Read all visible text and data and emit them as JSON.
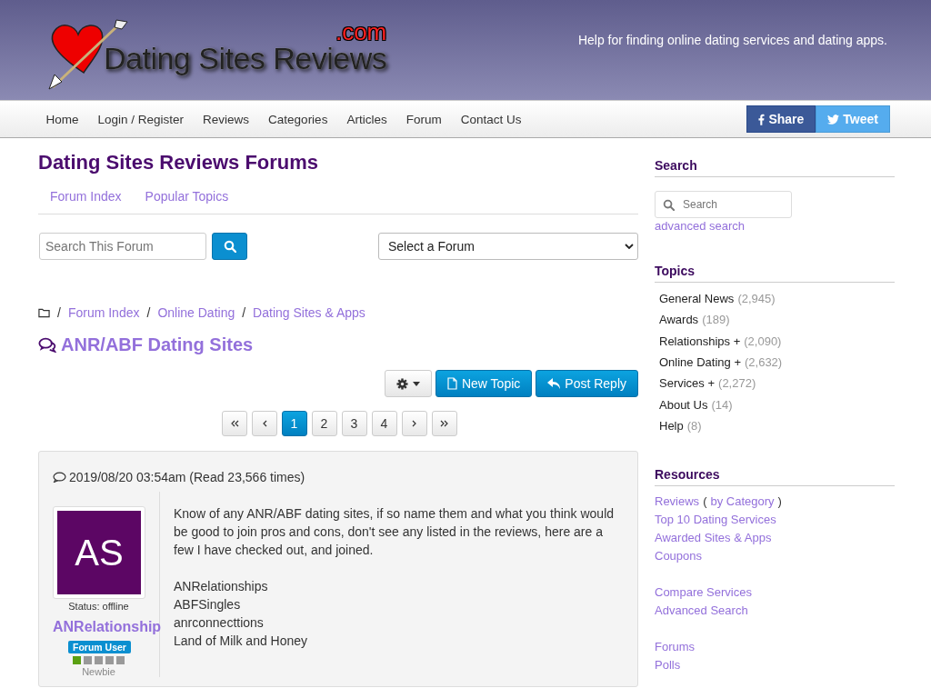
{
  "header": {
    "logo_text": "Dating Sites Reviews",
    "logo_suffix": ".com",
    "tagline": "Help for finding online dating services and dating apps."
  },
  "nav": {
    "items": [
      "Home",
      "Login / Register",
      "Reviews",
      "Categories",
      "Articles",
      "Forum",
      "Contact Us"
    ],
    "share": [
      {
        "kind": "facebook",
        "label": "Share"
      },
      {
        "kind": "twitter",
        "label": "Tweet"
      }
    ]
  },
  "page_title": "Dating Sites Reviews Forums",
  "tabs": [
    {
      "label": "Forum Index"
    },
    {
      "label": "Popular Topics"
    }
  ],
  "forum_search": {
    "placeholder": "Search This Forum"
  },
  "forum_select": {
    "value": "Select a Forum"
  },
  "breadcrumb": [
    {
      "sep": "/",
      "label": "Forum Index"
    },
    {
      "sep": "/",
      "label": "Online Dating"
    },
    {
      "sep": "/",
      "label": "Dating Sites & Apps"
    }
  ],
  "topic_title": "ANR/ABF Dating Sites",
  "actions": [
    {
      "kind": "tools"
    },
    {
      "kind": "new",
      "label": "New Topic"
    },
    {
      "kind": "reply",
      "label": "Post Reply"
    }
  ],
  "pagination": [
    {
      "kind": "first",
      "selected": false
    },
    {
      "kind": "prev",
      "selected": false
    },
    {
      "kind": "page",
      "label": "1",
      "selected": true
    },
    {
      "kind": "page",
      "label": "2",
      "selected": false
    },
    {
      "kind": "page",
      "label": "3",
      "selected": false
    },
    {
      "kind": "page",
      "label": "4",
      "selected": false
    },
    {
      "kind": "next",
      "selected": false
    },
    {
      "kind": "last",
      "selected": false
    }
  ],
  "post": {
    "meta": "2019/08/20 03:54am (Read 23,566 times)",
    "avatar_initials": "AS",
    "status": "Status: offline",
    "author": "ANRelationship",
    "role": "Forum User",
    "rank_pips": [
      {
        "on": true
      },
      {
        "on": false
      },
      {
        "on": false
      },
      {
        "on": false
      },
      {
        "on": false
      }
    ],
    "rank": "Newbie",
    "paragraphs": [
      [
        "Know of any ANR/ABF dating sites, if so name them and what you think would be good to join pros and cons, don't see any listed in the reviews, here are a few I have checked out, and joined."
      ],
      [
        "ANRelationships",
        "ABFSingles",
        "anrconnecttions",
        "Land of Milk and Honey"
      ]
    ]
  },
  "sidebar": {
    "search": {
      "heading": "Search",
      "placeholder": "Search",
      "link": "advanced search"
    },
    "topics": {
      "heading": "Topics",
      "items": [
        {
          "name": "General News",
          "count": "(2,945)"
        },
        {
          "name": "Awards",
          "count": "(189)"
        },
        {
          "name": "Relationships +",
          "count": "(2,090)"
        },
        {
          "name": "Online Dating +",
          "count": "(2,632)"
        },
        {
          "name": "Services +",
          "count": "(2,272)"
        },
        {
          "name": "About Us",
          "count": "(14)"
        },
        {
          "name": "Help",
          "count": "(8)"
        }
      ]
    },
    "resources": {
      "heading": "Resources",
      "groups": [
        [
          {
            "label": "Reviews",
            "open": "(",
            "extra": "by Category",
            "close": ")"
          },
          {
            "label": "Top 10 Dating Services"
          },
          {
            "label": "Awarded Sites & Apps"
          },
          {
            "label": "Coupons"
          }
        ],
        [
          {
            "label": "Compare Services"
          },
          {
            "label": "Advanced Search"
          }
        ],
        [
          {
            "label": "Forums"
          },
          {
            "label": "Polls"
          }
        ]
      ]
    }
  }
}
